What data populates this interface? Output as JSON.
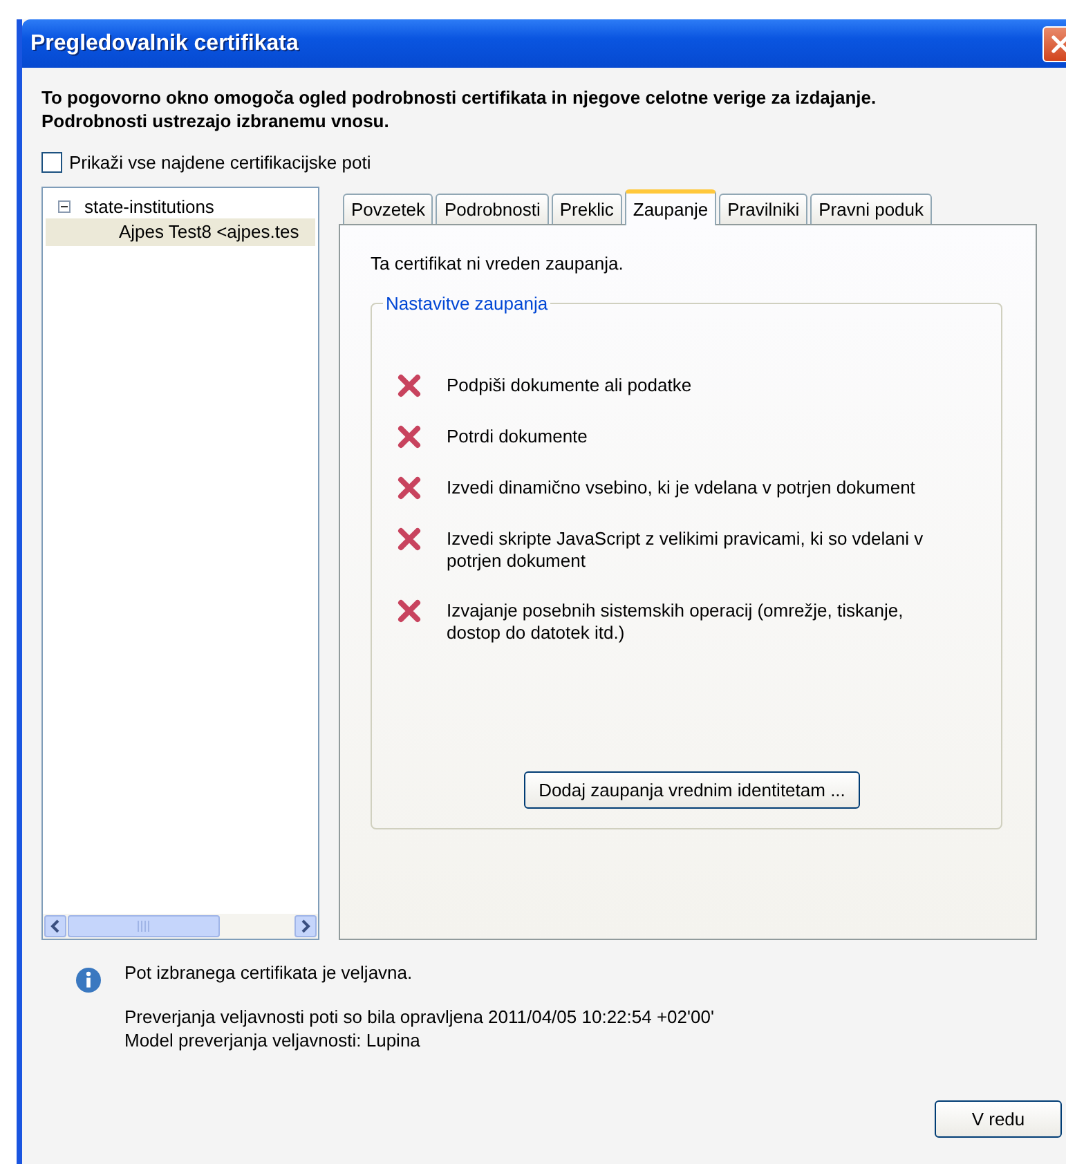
{
  "window": {
    "title": "Pregledovalnik certifikata"
  },
  "description": [
    "To pogovorno okno omogoča ogled podrobnosti certifikata in njegove celotne verige za izdajanje.",
    "Podrobnosti ustrezajo izbranemu vnosu."
  ],
  "show_all_paths": {
    "label": "Prikaži vse najdene certifikacijske poti",
    "checked": false
  },
  "tree": [
    {
      "label": "state-institutions",
      "expanded": true,
      "selected": false,
      "children": [
        {
          "label": "Ajpes Test8 <ajpes.tes",
          "selected": true
        }
      ]
    }
  ],
  "tabs": [
    {
      "label": "Povzetek",
      "selected": false
    },
    {
      "label": "Podrobnosti",
      "selected": false
    },
    {
      "label": "Preklic",
      "selected": false
    },
    {
      "label": "Zaupanje",
      "selected": true
    },
    {
      "label": "Pravilniki",
      "selected": false
    },
    {
      "label": "Pravni poduk",
      "selected": false
    }
  ],
  "trust": {
    "status": "Ta certifikat ni vreden zaupanja.",
    "group_title": "Nastavitve zaupanja",
    "items": [
      {
        "label": "Podpiši dokumente ali podatke",
        "allowed": false
      },
      {
        "label": "Potrdi dokumente",
        "allowed": false
      },
      {
        "label": "Izvedi dinamično vsebino, ki je vdelana v potrjen dokument",
        "allowed": false
      },
      {
        "label": "Izvedi skripte JavaScript z velikimi pravicami, ki so vdelani v potrjen dokument",
        "allowed": false
      },
      {
        "label": "Izvajanje posebnih sistemskih operacij (omrežje, tiskanje, dostop do datotek itd.)",
        "allowed": false
      }
    ],
    "button": "Dodaj zaupanja vrednim identitetam ..."
  },
  "info": {
    "message": "Pot izbranega certifikata je veljavna.",
    "details": [
      "Preverjanja veljavnosti poti so bila opravljena 2011/04/05 10:22:54 +02'00'",
      "Model preverjanja veljavnosti: Lupina"
    ]
  },
  "ok_button": "V redu"
}
